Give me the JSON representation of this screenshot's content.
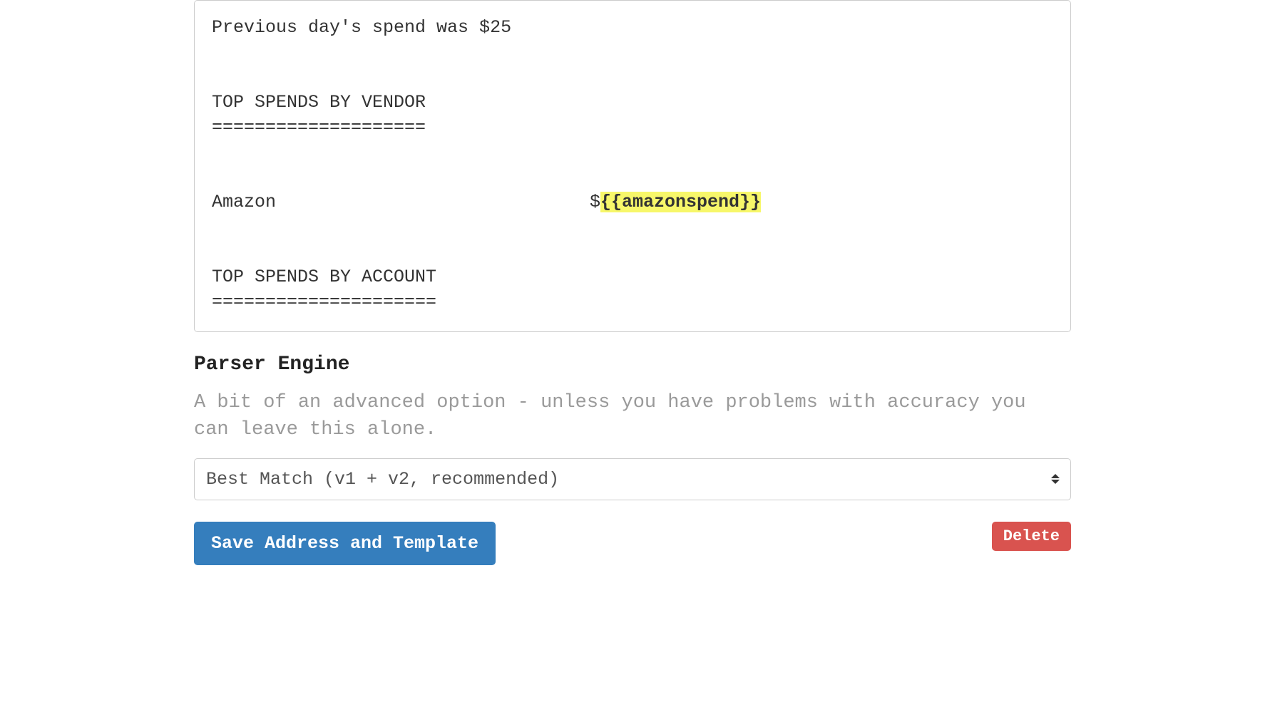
{
  "template": {
    "line1": "Previous day's spend was $25",
    "section1_title": "TOP SPENDS BY VENDOR",
    "section1_underline": "====================",
    "vendor_name": "Amazon",
    "vendor_prefix": "$",
    "vendor_variable": "{{amazonspend}}",
    "section2_title": "TOP SPENDS BY ACCOUNT",
    "section2_underline": "====================="
  },
  "parser": {
    "heading": "Parser Engine",
    "description": "A bit of an advanced option - unless you have problems with accuracy you can leave this alone.",
    "selected": "Best Match (v1 + v2, recommended)"
  },
  "buttons": {
    "save": "Save Address and Template",
    "delete": "Delete"
  }
}
